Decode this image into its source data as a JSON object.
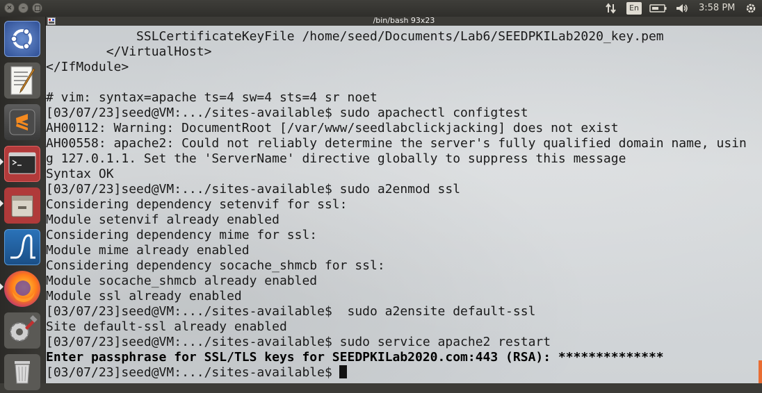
{
  "panel": {
    "window_title": "/bin/bash 93x23",
    "keyboard_lang": "En",
    "clock": "3:58 PM"
  },
  "launcher": {
    "items": [
      {
        "name": "ubuntu-dash-icon"
      },
      {
        "name": "text-editor-icon"
      },
      {
        "name": "sublime-text-icon"
      },
      {
        "name": "terminal-icon"
      },
      {
        "name": "file-manager-icon"
      },
      {
        "name": "wireshark-icon"
      },
      {
        "name": "firefox-icon"
      },
      {
        "name": "system-settings-icon"
      },
      {
        "name": "trash-icon"
      }
    ]
  },
  "terminal": {
    "lines": [
      {
        "text": "            SSLCertificateKeyFile /home/seed/Documents/Lab6/SEEDPKILab2020_key.pem",
        "bold": false
      },
      {
        "text": "        </VirtualHost>",
        "bold": false
      },
      {
        "text": "</IfModule>",
        "bold": false
      },
      {
        "text": "",
        "bold": false
      },
      {
        "text": "# vim: syntax=apache ts=4 sw=4 sts=4 sr noet",
        "bold": false
      },
      {
        "text": "[03/07/23]seed@VM:.../sites-available$ sudo apachectl configtest",
        "bold": false
      },
      {
        "text": "AH00112: Warning: DocumentRoot [/var/www/seedlabclickjacking] does not exist",
        "bold": false
      },
      {
        "text": "AH00558: apache2: Could not reliably determine the server's fully qualified domain name, usin",
        "bold": false
      },
      {
        "text": "g 127.0.1.1. Set the 'ServerName' directive globally to suppress this message",
        "bold": false
      },
      {
        "text": "Syntax OK",
        "bold": false
      },
      {
        "text": "[03/07/23]seed@VM:.../sites-available$ sudo a2enmod ssl",
        "bold": false
      },
      {
        "text": "Considering dependency setenvif for ssl:",
        "bold": false
      },
      {
        "text": "Module setenvif already enabled",
        "bold": false
      },
      {
        "text": "Considering dependency mime for ssl:",
        "bold": false
      },
      {
        "text": "Module mime already enabled",
        "bold": false
      },
      {
        "text": "Considering dependency socache_shmcb for ssl:",
        "bold": false
      },
      {
        "text": "Module socache_shmcb already enabled",
        "bold": false
      },
      {
        "text": "Module ssl already enabled",
        "bold": false
      },
      {
        "text": "[03/07/23]seed@VM:.../sites-available$  sudo a2ensite default-ssl",
        "bold": false
      },
      {
        "text": "Site default-ssl already enabled",
        "bold": false
      },
      {
        "text": "[03/07/23]seed@VM:.../sites-available$ sudo service apache2 restart",
        "bold": false
      },
      {
        "text": "Enter passphrase for SSL/TLS keys for SEEDPKILab2020.com:443 (RSA): **************",
        "bold": true
      },
      {
        "text": "[03/07/23]seed@VM:.../sites-available$",
        "bold": false,
        "cursor": true
      }
    ]
  }
}
